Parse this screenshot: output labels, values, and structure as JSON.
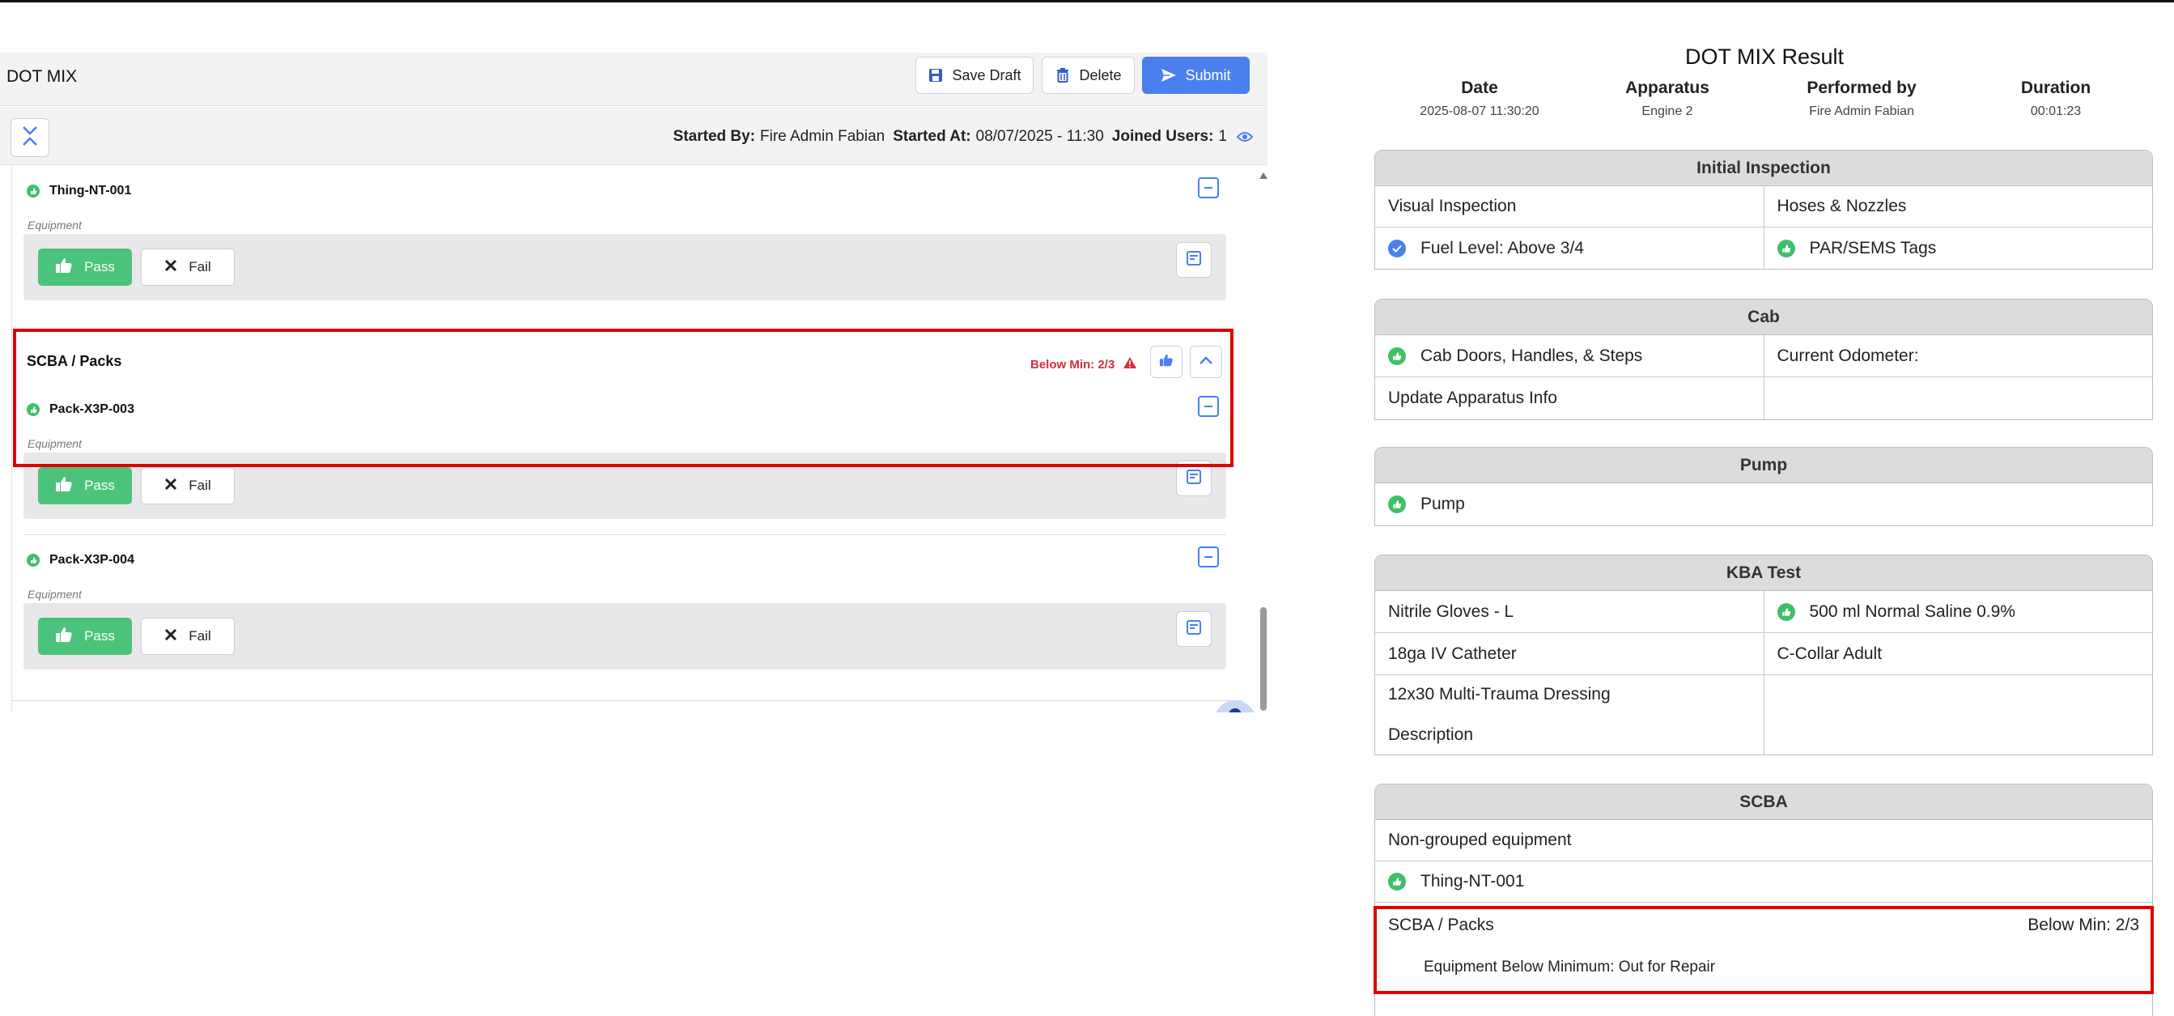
{
  "left": {
    "title": "DOT MIX",
    "toolbar": {
      "save_draft": "Save Draft",
      "delete": "Delete",
      "submit": "Submit"
    },
    "started": {
      "started_by_label": "Started By:",
      "started_by": "Fire Admin Fabian",
      "started_at_label": "Started At:",
      "started_at": "08/07/2025 - 11:30",
      "joined_label": "Joined Users:",
      "joined": "1"
    },
    "items": [
      {
        "name": "Thing-NT-001",
        "tag": "Equipment",
        "pass": "Pass",
        "fail": "Fail"
      },
      {
        "name": "Pack-X3P-003",
        "tag": "Equipment",
        "pass": "Pass",
        "fail": "Fail"
      },
      {
        "name": "Pack-X3P-004",
        "tag": "Equipment",
        "pass": "Pass",
        "fail": "Fail"
      }
    ],
    "group": {
      "title": "SCBA / Packs",
      "below_min": "Below Min: 2/3"
    }
  },
  "right": {
    "title": "DOT MIX Result",
    "meta": [
      {
        "label": "Date",
        "value": "2025-08-07 11:30:20"
      },
      {
        "label": "Apparatus",
        "value": "Engine 2"
      },
      {
        "label": "Performed by",
        "value": "Fire Admin Fabian"
      },
      {
        "label": "Duration",
        "value": "00:01:23"
      }
    ],
    "initial_inspection": {
      "title": "Initial Inspection",
      "r1c1": "Visual Inspection",
      "r1c2": "Hoses & Nozzles",
      "r2c1": "Fuel Level: Above 3/4",
      "r2c2": "PAR/SEMS Tags"
    },
    "cab": {
      "title": "Cab",
      "r1c1": "Cab Doors, Handles, & Steps",
      "r1c2": "Current Odometer:",
      "r2c1": "Update Apparatus Info",
      "r2c2": ""
    },
    "pump": {
      "title": "Pump",
      "r1c1": "Pump"
    },
    "kba": {
      "title": "KBA Test",
      "r1c1": "Nitrile Gloves - L",
      "r1c2": "500 ml Normal Saline 0.9%",
      "r2c1": "18ga IV Catheter",
      "r2c2": "C-Collar Adult",
      "r3c1a": "12x30 Multi-Trauma Dressing",
      "r3c1b": "Description",
      "r3c2": ""
    },
    "scba": {
      "title": "SCBA",
      "non_grouped": "Non-grouped equipment",
      "thing": "Thing-NT-001",
      "group": "SCBA / Packs",
      "below_min": "Below Min: 2/3",
      "note": "Equipment Below Minimum: Out for Repair"
    }
  },
  "colors": {
    "accent": "#4a7ff0",
    "pass": "#4cc37b",
    "alert": "#d32f3f",
    "highlight": "#e00000"
  }
}
